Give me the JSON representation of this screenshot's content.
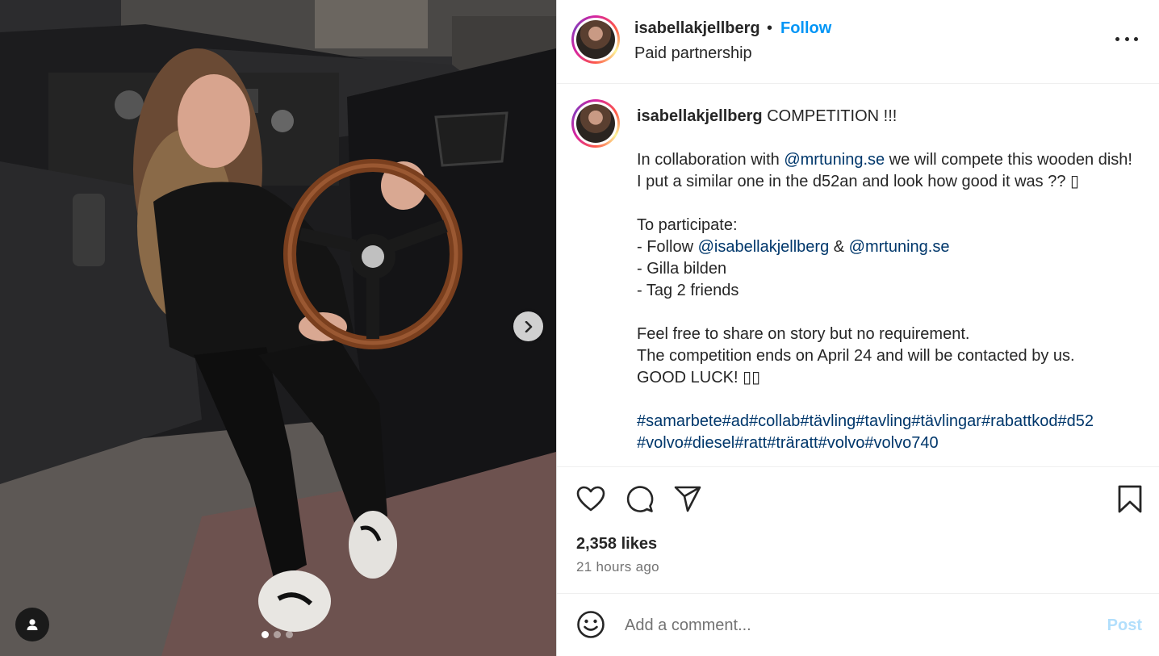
{
  "post": {
    "username": "isabellakjellberg",
    "separator": "•",
    "follow_label": "Follow",
    "subtitle": "Paid partnership",
    "more_icon": "more-horizontal-icon"
  },
  "media": {
    "carousel_count": 3,
    "carousel_active_index": 0,
    "next_icon": "chevron-right-icon",
    "tag_icon": "user-tag-icon"
  },
  "caption": {
    "username": "isabellakjellberg",
    "line1": " COMPETITION !!!",
    "p1_a": "In collaboration with ",
    "mention_mrtuning": "@mrtuning.se",
    "p1_b": " we will compete this wooden dish! I put a similar one in the d52an and look how good it was ?? ▯",
    "to_participate": "To participate:",
    "step1_a": "- Follow ",
    "mention_isabella": "@isabellakjellberg",
    "step1_amp": " & ",
    "mention_mrtuning2": "@mrtuning.se",
    "step2": "- Gilla bilden",
    "step3": "- Tag 2 friends",
    "p3_1": "Feel free to share on story but no requirement.",
    "p3_2": "The competition ends on April 24 and will be contacted by us.",
    "p3_3": "GOOD LUCK! ▯▯",
    "hashtags_1": "#samarbete#ad#collab#tävling#tavling#tävlingar#rabattkod#d52",
    "hashtags_2": "#volvo#diesel#ratt#träratt#volvo#volvo740"
  },
  "actions": {
    "like_icon": "heart-icon",
    "comment_icon": "comment-icon",
    "share_icon": "send-icon",
    "save_icon": "bookmark-icon",
    "likes": "2,358 likes",
    "time": "21 hours ago"
  },
  "comment": {
    "emoji_icon": "emoji-icon",
    "placeholder": "Add a comment...",
    "post_label": "Post"
  },
  "colors": {
    "link": "#0095f6",
    "mention": "#00376b",
    "post_disabled": "#b2dffc",
    "text": "#262626",
    "muted": "#737373"
  }
}
